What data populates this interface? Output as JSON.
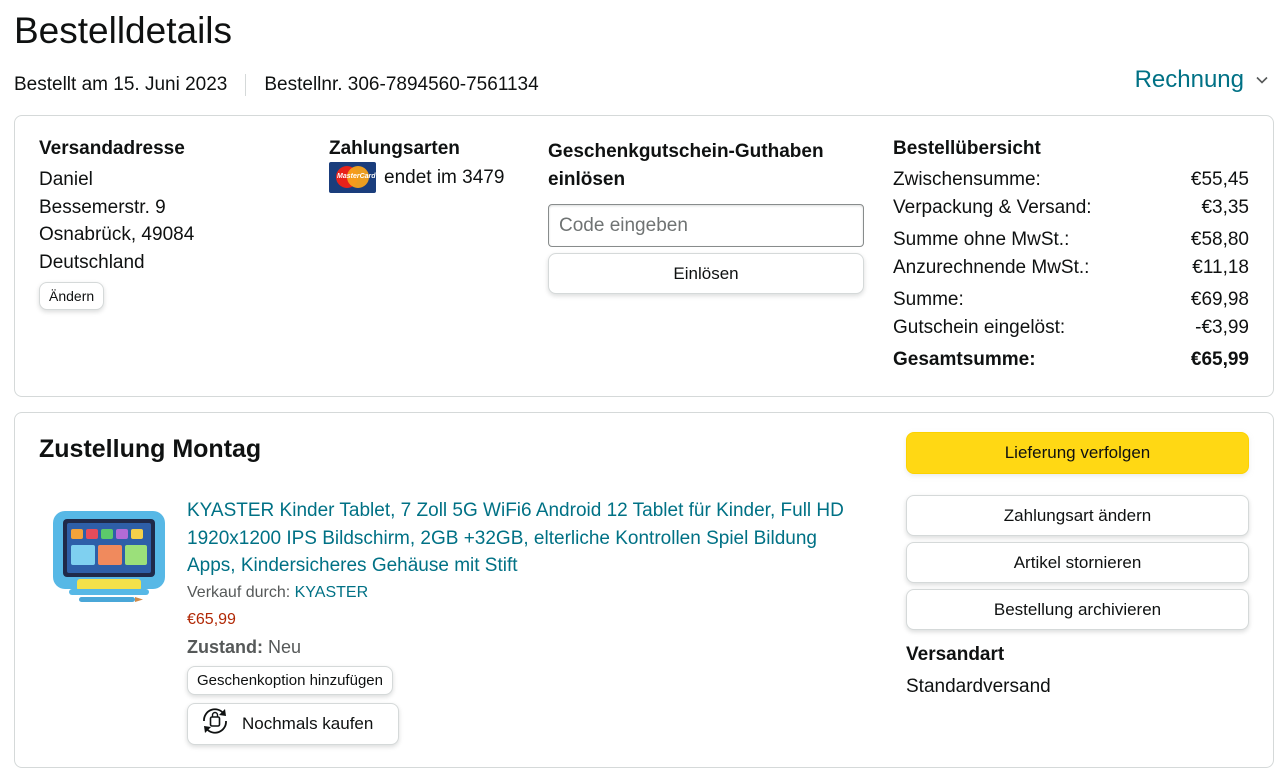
{
  "page": {
    "title": "Bestelldetails",
    "order_date": "Bestellt am 15. Juni 2023",
    "order_number": "Bestellnr. 306-7894560-7561134",
    "invoice_label": "Rechnung"
  },
  "address": {
    "heading": "Versandadresse",
    "lines": [
      "Daniel",
      "Bessemerstr. 9",
      "Osnabrück, 49084",
      "Deutschland"
    ],
    "change_label": "Ändern"
  },
  "payment": {
    "heading": "Zahlungsarten",
    "card_text": "endet im 3479",
    "card_brand_label": "MasterCard",
    "icon": "mastercard-icon"
  },
  "gift_card": {
    "heading": "Geschenkgutschein-Guthaben einlösen",
    "input_placeholder": "Code eingeben",
    "redeem_label": "Einlösen"
  },
  "summary": {
    "heading": "Bestellübersicht",
    "rows": [
      {
        "label": "Zwischensumme:",
        "value": "€55,45"
      },
      {
        "label": "Verpackung & Versand:",
        "value": "€3,35"
      },
      {
        "label": "Summe ohne MwSt.:",
        "value": "€58,80"
      },
      {
        "label": "Anzurechnende MwSt.:",
        "value": "€11,18"
      },
      {
        "label": "Summe:",
        "value": "€69,98"
      },
      {
        "label": "Gutschein eingelöst:",
        "value": "-€3,99"
      },
      {
        "label": "Gesamtsumme:",
        "value": "€65,99"
      }
    ]
  },
  "delivery": {
    "heading": "Zustellung Montag",
    "product": {
      "title": "KYASTER Kinder Tablet, 7 Zoll 5G WiFi6 Android 12 Tablet für Kinder, Full HD 1920x1200 IPS Bildschirm, 2GB +32GB, elterliche Kontrollen Spiel Bildung Apps, Kindersicheres Gehäuse mit Stift",
      "seller_prefix": "Verkauf durch:",
      "seller": "KYASTER",
      "price": "€65,99",
      "condition_label": "Zustand:",
      "condition_value": "Neu",
      "gift_option_label": "Geschenkoption hinzufügen",
      "rebuy_label": "Nochmals kaufen"
    },
    "actions": {
      "track": "Lieferung verfolgen",
      "change_payment": "Zahlungsart ändern",
      "cancel": "Artikel stornieren",
      "archive": "Bestellung archivieren"
    },
    "shipping_heading": "Versandart",
    "shipping_value": "Standardversand"
  },
  "colors": {
    "link": "#007185",
    "price": "#b12704",
    "primary_button": "#ffd814",
    "border": "#d5d9d9"
  }
}
